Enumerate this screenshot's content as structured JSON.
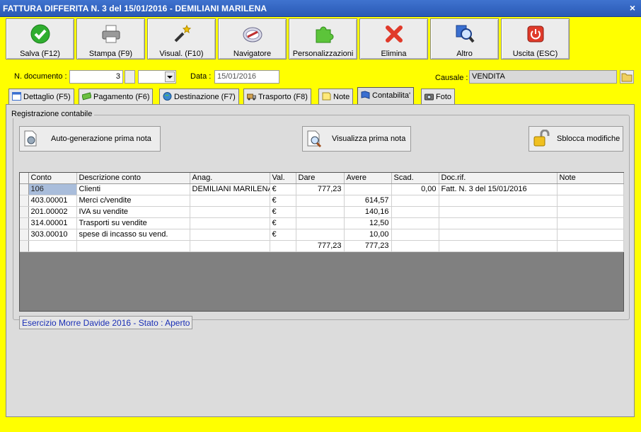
{
  "window": {
    "title": "FATTURA DIFFERITA N. 3 del 15/01/2016 - DEMILIANI MARILENA",
    "close": "×"
  },
  "toolbar": [
    {
      "label": "Salva (F12)",
      "icon": "check-icon"
    },
    {
      "label": "Stampa (F9)",
      "icon": "printer-icon"
    },
    {
      "label": "Visual. (F10)",
      "icon": "magic-wand-icon"
    },
    {
      "label": "Navigatore",
      "icon": "compass-icon"
    },
    {
      "label": "Personalizzazioni",
      "icon": "puzzle-icon"
    },
    {
      "label": "Elimina",
      "icon": "delete-x-icon"
    },
    {
      "label": "Altro",
      "icon": "magnifier-icon"
    },
    {
      "label": "Uscita (ESC)",
      "icon": "power-icon"
    }
  ],
  "doc": {
    "number_label": "N. documento :",
    "number_value": "3",
    "suffix_value": "",
    "date_label": "Data :",
    "date_value": "15/01/2016",
    "causale_label": "Causale :",
    "causale_value": "VENDITA"
  },
  "tabs": [
    {
      "label": "Dettaglio (F5)",
      "icon": "calendar-icon",
      "active": false
    },
    {
      "label": "Pagamento (F6)",
      "icon": "money-icon",
      "active": false
    },
    {
      "label": "Destinazione (F7)",
      "icon": "globe-icon",
      "active": false
    },
    {
      "label": "Trasporto (F8)",
      "icon": "truck-icon",
      "active": false
    },
    {
      "label": "Note",
      "icon": "note-icon",
      "active": false
    },
    {
      "label": "Contabilita'",
      "icon": "book-icon",
      "active": true
    },
    {
      "label": "Foto",
      "icon": "camera-icon",
      "active": false
    }
  ],
  "contabilita": {
    "group_title": "Registrazione contabile",
    "btn_autogen": "Auto-generazione prima nota",
    "btn_visualizza": "Visualizza prima nota",
    "btn_sblocca": "Sblocca modifiche",
    "columns": [
      "Conto",
      "Descrizione conto",
      "Anag.",
      "Val.",
      "Dare",
      "Avere",
      "Scad.",
      "Doc.rif.",
      "Note"
    ],
    "rows": [
      [
        "106",
        "Clienti",
        "DEMILIANI MARILENA",
        "€",
        "777,23",
        "",
        "0,00",
        "Fatt. N. 3 del 15/01/2016",
        ""
      ],
      [
        "403.00001",
        "Merci c/vendite",
        "",
        "€",
        "",
        "614,57",
        "",
        "",
        ""
      ],
      [
        "201.00002",
        "IVA su vendite",
        "",
        "€",
        "",
        "140,16",
        "",
        "",
        ""
      ],
      [
        "314.00001",
        "Trasporti su vendite",
        "",
        "€",
        "",
        "12,50",
        "",
        "",
        ""
      ],
      [
        "303.00010",
        "spese di incasso su vend.",
        "",
        "€",
        "",
        "10,00",
        "",
        "",
        ""
      ]
    ],
    "totals": {
      "dare": "777,23",
      "avere": "777,23"
    },
    "status": "Esercizio Morre Davide 2016 - Stato : Aperto"
  }
}
